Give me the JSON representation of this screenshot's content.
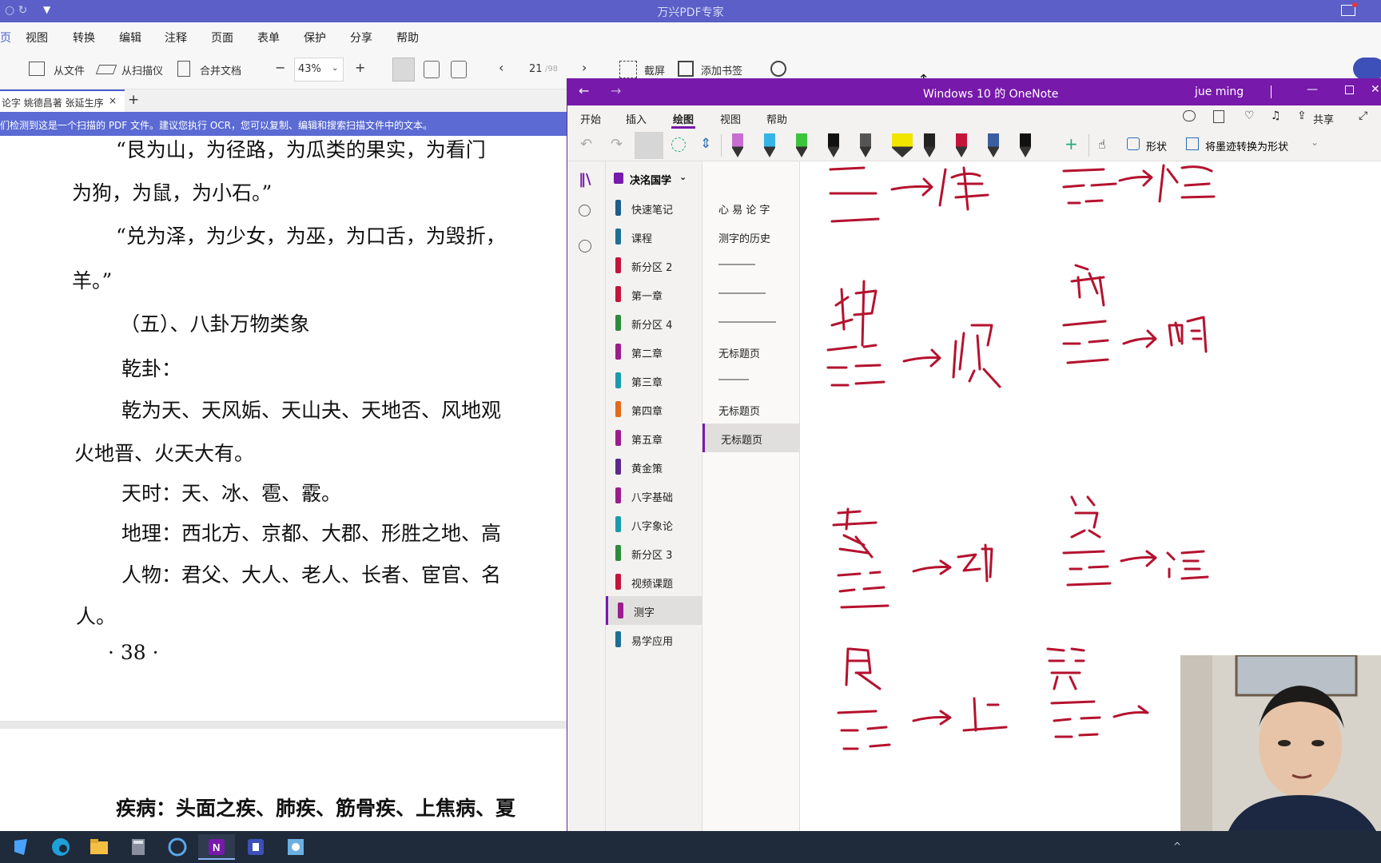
{
  "pdf": {
    "app_title": "万兴PDF专家",
    "menu": [
      "视图",
      "转换",
      "编辑",
      "注释",
      "页面",
      "表单",
      "保护",
      "分享",
      "帮助"
    ],
    "menu_left_fragment": "页",
    "toolbar": {
      "from_file": "从文件",
      "from_scanner": "从扫描仪",
      "merge": "合并文档",
      "zoom_minus": "−",
      "zoom_value": "43%",
      "zoom_plus": "+",
      "page_prev": "‹",
      "page_value": "21",
      "page_total": "/98",
      "page_next": "›",
      "screenshot": "截屏",
      "add_bookmark": "添加书签"
    },
    "tab_label": "论字 姚德昌著 张延生序",
    "notice": "们检测到这是一个扫描的 PDF 文件。建议您执行 OCR，您可以复制、编辑和搜索扫描文件中的文本。",
    "page_lines": [
      "“艮为山，为径路，为瓜类的果实，为看门",
      "为狗，为鼠，为小石。”",
      "“兑为泽，为少女，为巫，为口舌，为毁折，",
      "羊。”",
      "（五）、八卦万物类象",
      "乾卦：",
      "乾为天、天风姤、天山夬、天地否、风地观",
      "火地晋、火天大有。",
      "天时：天、冰、雹、霰。",
      "地理：西北方、京都、大郡、形胜之地、高",
      "人物：君父、大人、老人、长者、宦官、名",
      "人。",
      "· 38 ·",
      "疾病：头面之疾、肺疾、筋骨疾、上焦病、夏"
    ]
  },
  "onenote": {
    "title": "Windows 10 的 OneNote",
    "user": "jue ming",
    "tabs": [
      "开始",
      "插入",
      "绘图",
      "视图",
      "帮助"
    ],
    "active_tab": "绘图",
    "share": "共享",
    "shapes": "形状",
    "convert": "将墨迹转换为形状",
    "notebook": "决洺国学",
    "sections": [
      {
        "label": "快速笔记",
        "color": "#1e5f8a"
      },
      {
        "label": "课程",
        "color": "#1e6f95"
      },
      {
        "label": "新分区 2",
        "color": "#c4143c"
      },
      {
        "label": "第一章",
        "color": "#c4143c"
      },
      {
        "label": "新分区 4",
        "color": "#2e8b3c"
      },
      {
        "label": "第二章",
        "color": "#9b1d8c"
      },
      {
        "label": "第三章",
        "color": "#1a9bab"
      },
      {
        "label": "第四章",
        "color": "#e06b1a"
      },
      {
        "label": "第五章",
        "color": "#9b1d8c"
      },
      {
        "label": "黄金策",
        "color": "#5a2a8a"
      },
      {
        "label": "八字基础",
        "color": "#9b1d8c"
      },
      {
        "label": "八字象论",
        "color": "#1a9bab"
      },
      {
        "label": "新分区 3",
        "color": "#2e8b3c"
      },
      {
        "label": "视频课题",
        "color": "#c4143c"
      },
      {
        "label": "测字",
        "color": "#9b1d8c"
      },
      {
        "label": "易学应用",
        "color": "#1e6f95"
      }
    ],
    "pages": [
      "心 易 论 字",
      "测字的历史",
      "",
      "",
      "",
      "无标题页",
      "",
      "无标题页",
      "无标题页"
    ],
    "ink_color": "#b5122f"
  },
  "taskbar": {
    "icons": [
      "start-icon",
      "edge-icon",
      "file-explorer-icon",
      "calculator-icon",
      "app-icon",
      "onenote-icon",
      "pdf-app-icon",
      "control-panel-icon"
    ]
  }
}
